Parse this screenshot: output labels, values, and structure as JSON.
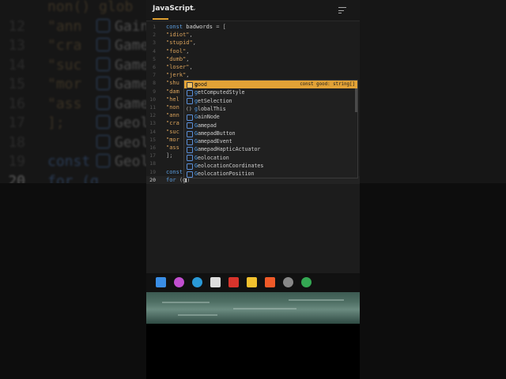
{
  "background_zoom": {
    "lines": [
      {
        "ln": "",
        "text": "non() glob"
      },
      {
        "ln": "12",
        "text": "\"ann",
        "suggest": "GainN"
      },
      {
        "ln": "13",
        "text": "\"cra",
        "suggest": "Gamep"
      },
      {
        "ln": "14",
        "text": "\"suc",
        "suggest": "Gamep"
      },
      {
        "ln": "15",
        "text": "\"mor",
        "suggest": "Gamep"
      },
      {
        "ln": "16",
        "text": "\"ass",
        "suggest": "Gamep"
      },
      {
        "ln": "17",
        "text": "];",
        "suggest": "Geolo"
      },
      {
        "ln": "18",
        "text": "",
        "suggest": "Geolo"
      },
      {
        "ln": "19",
        "text": "const",
        "suggest": "Geolo"
      },
      {
        "ln": "20",
        "text": "for (g"
      }
    ]
  },
  "editor": {
    "language": "JavaScript",
    "lines": [
      {
        "ln": "1",
        "parts": [
          [
            "c-kw",
            "const "
          ],
          [
            "c-id",
            "badwords"
          ],
          [
            "c-punc",
            " = ["
          ]
        ]
      },
      {
        "ln": "2",
        "parts": [
          [
            "c-str",
            "  \"idiot\""
          ],
          [
            "c-punc",
            ","
          ]
        ]
      },
      {
        "ln": "3",
        "parts": [
          [
            "c-str",
            "  \"stupid\""
          ],
          [
            "c-punc",
            ","
          ]
        ]
      },
      {
        "ln": "4",
        "parts": [
          [
            "c-str",
            "  \"fool\""
          ],
          [
            "c-punc",
            ","
          ]
        ]
      },
      {
        "ln": "5",
        "parts": [
          [
            "c-str",
            "  \"dumb\""
          ],
          [
            "c-punc",
            ","
          ]
        ]
      },
      {
        "ln": "6",
        "parts": [
          [
            "c-str",
            "  \"loser\""
          ],
          [
            "c-punc",
            ","
          ]
        ]
      },
      {
        "ln": "7",
        "parts": [
          [
            "c-str",
            "  \"jerk\""
          ],
          [
            "c-punc",
            ","
          ]
        ]
      },
      {
        "ln": "8",
        "parts": [
          [
            "c-str",
            "  \"shu"
          ]
        ]
      },
      {
        "ln": "9",
        "parts": [
          [
            "c-str",
            "  \"dam"
          ]
        ]
      },
      {
        "ln": "10",
        "parts": [
          [
            "c-str",
            "  \"hel"
          ]
        ]
      },
      {
        "ln": "11",
        "parts": [
          [
            "c-str",
            "  \"non"
          ]
        ]
      },
      {
        "ln": "12",
        "parts": [
          [
            "c-str",
            "  \"ann"
          ]
        ]
      },
      {
        "ln": "13",
        "parts": [
          [
            "c-str",
            "  \"cra"
          ]
        ]
      },
      {
        "ln": "14",
        "parts": [
          [
            "c-str",
            "  \"suc"
          ]
        ]
      },
      {
        "ln": "15",
        "parts": [
          [
            "c-str",
            "  \"mor"
          ]
        ]
      },
      {
        "ln": "16",
        "parts": [
          [
            "c-str",
            "  \"ass"
          ]
        ]
      },
      {
        "ln": "17",
        "parts": [
          [
            "c-punc",
            "];"
          ]
        ]
      },
      {
        "ln": "18",
        "parts": []
      },
      {
        "ln": "19",
        "parts": [
          [
            "c-kw",
            "const "
          ]
        ]
      },
      {
        "ln": "20",
        "parts": [
          [
            "c-kw",
            "for "
          ],
          [
            "c-punc",
            "("
          ],
          [
            "c-id",
            "g"
          ]
        ],
        "active": true
      }
    ]
  },
  "suggestions": [
    {
      "label": "good",
      "match": "g",
      "rest": "ood",
      "kind": "var",
      "detail": "const good: string[]",
      "selected": true
    },
    {
      "label": "getComputedStyle",
      "match": "g",
      "rest": "etComputedStyle",
      "kind": "fn"
    },
    {
      "label": "getSelection",
      "match": "g",
      "rest": "etSelection",
      "kind": "fn"
    },
    {
      "label": "globalThis",
      "match": "g",
      "rest": "lobalThis",
      "kind": "braces"
    },
    {
      "label": "GainNode",
      "match": "G",
      "rest": "ainNode",
      "kind": "class"
    },
    {
      "label": "Gamepad",
      "match": "G",
      "rest": "amepad",
      "kind": "class"
    },
    {
      "label": "GamepadButton",
      "match": "G",
      "rest": "amepadButton",
      "kind": "class"
    },
    {
      "label": "GamepadEvent",
      "match": "G",
      "rest": "amepadEvent",
      "kind": "class"
    },
    {
      "label": "GamepadHapticActuator",
      "match": "G",
      "rest": "amepadHapticActuator",
      "kind": "class"
    },
    {
      "label": "Geolocation",
      "match": "G",
      "rest": "eolocation",
      "kind": "class"
    },
    {
      "label": "GeolocationCoordinates",
      "match": "G",
      "rest": "eolocationCoordinates",
      "kind": "class"
    },
    {
      "label": "GeolocationPosition",
      "match": "G",
      "rest": "eolocationPosition",
      "kind": "class"
    }
  ],
  "taskbar": {
    "icons": [
      {
        "name": "windows-start-icon",
        "color": "#3a8ee6"
      },
      {
        "name": "copilot-icon",
        "color": "#c24fd0"
      },
      {
        "name": "edge-icon",
        "color": "#2a9ad8"
      },
      {
        "name": "app-icon",
        "color": "#dddddd"
      },
      {
        "name": "l-app-icon",
        "color": "#d8342c"
      },
      {
        "name": "file-explorer-icon",
        "color": "#f2c12e"
      },
      {
        "name": "brave-icon",
        "color": "#f05a28"
      },
      {
        "name": "spotlight-icon",
        "color": "#888888"
      },
      {
        "name": "chrome-icon",
        "color": "#34a853"
      }
    ]
  }
}
